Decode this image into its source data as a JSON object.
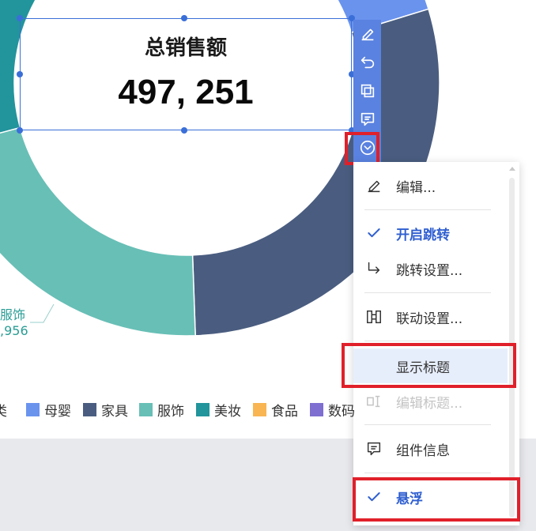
{
  "colors": {
    "accent": "#5a82e0",
    "selection": "#3a6fd8",
    "highlight_box": "#e0202a",
    "menu_checked": "#2f5fd0",
    "muyi": "#6a93ee",
    "jiaju": "#4a5d80",
    "fushi": "#68bfb6",
    "meizhuang": "#22949b",
    "shipin": "#f8b552",
    "shuma": "#7e6fd0"
  },
  "kpi": {
    "title": "总销售额",
    "value": "497, 251"
  },
  "toolbar": {
    "icons": [
      "edit-icon",
      "undo-icon",
      "copy-icon",
      "comment-icon",
      "chevron-down-circle-icon"
    ]
  },
  "menu": {
    "edit_label": "编辑...",
    "enable_jump_label": "开启跳转",
    "jump_settings_label": "跳转设置...",
    "linkage_settings_label": "联动设置...",
    "show_title_label": "显示标题",
    "edit_title_label": "编辑标题...",
    "component_info_label": "组件信息",
    "float_label": "悬浮"
  },
  "callout": {
    "line1": "服饰",
    "line2": ",956"
  },
  "legend": {
    "partial_first": "类",
    "items": [
      "母婴",
      "家具",
      "服饰",
      "美妆",
      "食品",
      "数码"
    ]
  }
}
